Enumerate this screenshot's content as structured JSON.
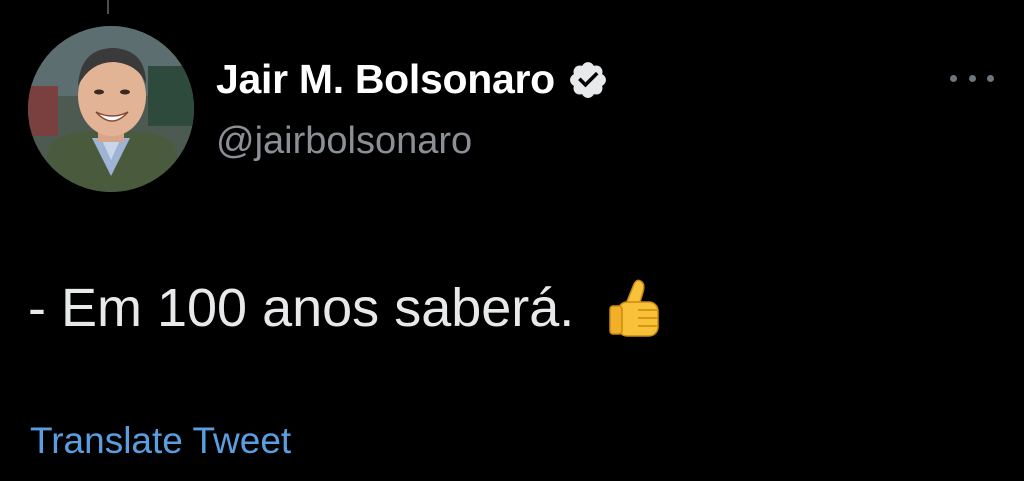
{
  "tweet": {
    "author": {
      "display_name": "Jair M. Bolsonaro",
      "handle": "@jairbolsonaro",
      "verified": true,
      "avatar_icon": "profile-photo"
    },
    "text": "- Em 100 anos saberá.",
    "emoji": "thumbs-up",
    "translate_label": "Translate Tweet",
    "more_icon": "more-horizontal-icon"
  },
  "colors": {
    "background": "#000000",
    "name": "#ffffff",
    "handle": "#8b9096",
    "body_text": "#e7e9ea",
    "link": "#5a9de0",
    "verified_badge": "#e7e9ea"
  }
}
